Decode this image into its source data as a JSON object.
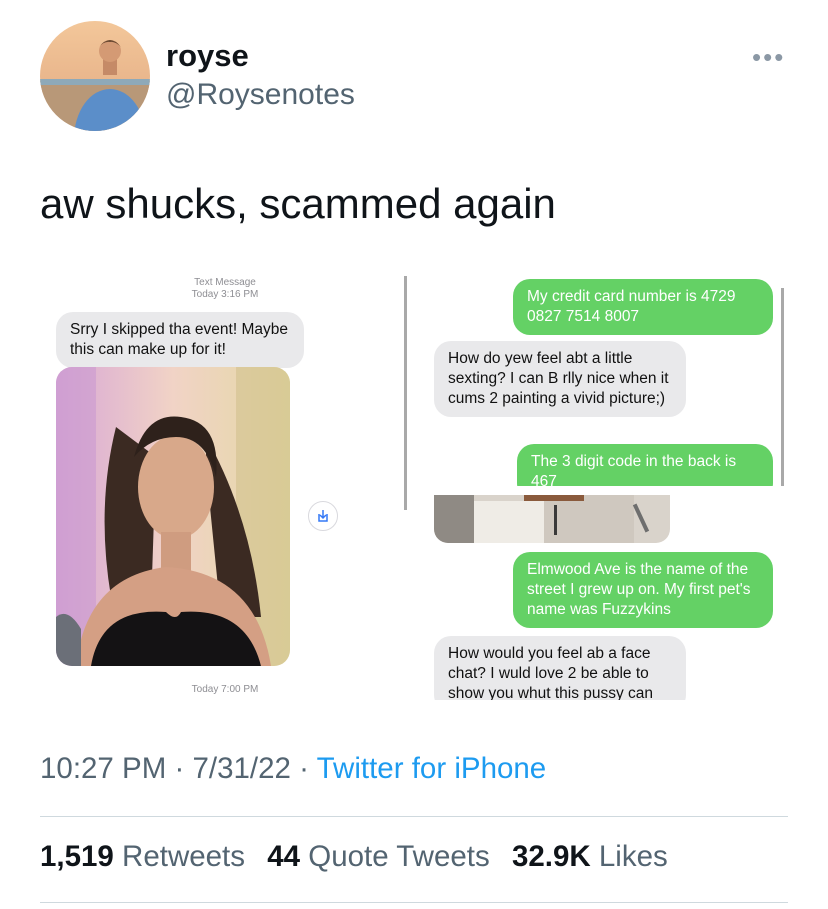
{
  "author": {
    "display_name": "royse",
    "handle": "@Roysenotes"
  },
  "tweet": {
    "text": "aw shucks, scammed again"
  },
  "screenshots": {
    "left": {
      "header_line1": "Text Message",
      "header_line2": "Today 3:16 PM",
      "incoming_message": "Srry I skipped tha event! Maybe this can make up for it!",
      "timestamp_bottom": "Today 7:00 PM"
    },
    "right": {
      "messages": [
        {
          "side": "out",
          "text": "My credit card number is 4729 0827 7514 8007"
        },
        {
          "side": "in",
          "text": "How do yew feel abt a little sexting? I can B rlly nice when it cums 2 painting a vivid picture;)"
        },
        {
          "side": "out",
          "text": "The 3 digit code in the back is 467"
        },
        {
          "side": "out",
          "text": "Elmwood Ave is the name of the street I grew up on. My first pet's name was Fuzzykins"
        },
        {
          "side": "in",
          "text": "How would you feel ab a face chat? I wuld love 2 be able to show you whut this pussy can"
        }
      ]
    }
  },
  "meta": {
    "time": "10:27 PM",
    "date": "7/31/22",
    "separator": "·",
    "source": "Twitter for iPhone"
  },
  "stats": {
    "retweets_count": "1,519",
    "retweets_label": "Retweets",
    "quotes_count": "44",
    "quotes_label": "Quote Tweets",
    "likes_count": "32.9K",
    "likes_label": "Likes"
  },
  "icons": {
    "more": "more-horizontal-icon",
    "save": "save-to-photos-icon"
  },
  "colors": {
    "imessage_blue_green": "#64d165",
    "incoming_gray": "#e9e9eb",
    "link_blue": "#1d9bf0",
    "secondary_text": "#536471"
  }
}
